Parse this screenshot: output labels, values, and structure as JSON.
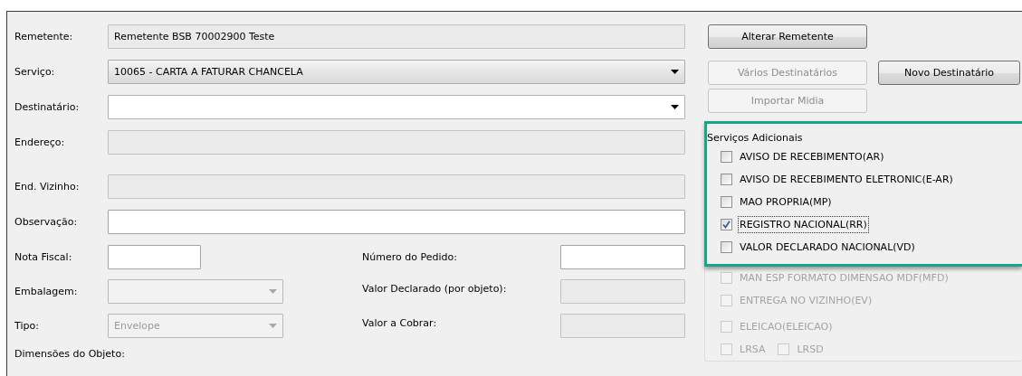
{
  "main_fields": [
    {
      "label": "Remetente:",
      "kind": "text",
      "editable": false,
      "value": "Remetente BSB 70002900 Teste"
    },
    {
      "label": "Serviço:",
      "kind": "select",
      "disabled": false,
      "value": "10065 - CARTA A FATURAR CHANCELA"
    },
    {
      "label": "Destinatário:",
      "kind": "combo",
      "disabled": false
    },
    {
      "label": "Endereço:",
      "kind": "text",
      "editable": false
    },
    {
      "label": "End. Vizinho:",
      "kind": "text",
      "editable": false
    },
    {
      "label": "Observação:",
      "kind": "text",
      "editable": true
    }
  ],
  "detail_left": [
    {
      "label": "Nota Fiscal:",
      "kind": "text",
      "editable": true
    },
    {
      "label": "Embalagem:",
      "kind": "select",
      "disabled": true
    },
    {
      "label": "Tipo:",
      "kind": "select",
      "disabled": true,
      "value": "Envelope"
    }
  ],
  "detail_right": [
    {
      "label": "Número do Pedido:",
      "kind": "text",
      "editable": true
    },
    {
      "label": "Valor Declarado (por objeto):",
      "kind": "text",
      "editable": false
    },
    {
      "label": "Valor a Cobrar:",
      "kind": "text",
      "editable": false
    }
  ],
  "dimensions_label": "Dimensões do Objeto:",
  "button_rows": [
    [
      {
        "label": "Alterar Remetente",
        "disabled": false
      }
    ],
    [
      {
        "label": "Vários Destinatários",
        "disabled": true
      },
      {
        "label": "Novo Destinatário",
        "disabled": false
      }
    ],
    [
      {
        "label": "Importar Midia",
        "disabled": true
      }
    ]
  ],
  "additional_services": {
    "title": "Serviços Adicionais",
    "highlighted_rows": [
      [
        {
          "label": "AVISO DE RECEBIMENTO(AR)",
          "checked": false,
          "disabled": false,
          "focused": false
        }
      ],
      [
        {
          "label": "AVISO DE RECEBIMENTO ELETRONIC(E-AR)",
          "checked": false,
          "disabled": false,
          "focused": false
        }
      ],
      [
        {
          "label": "MAO PROPRIA(MP)",
          "checked": false,
          "disabled": false,
          "focused": false
        }
      ],
      [
        {
          "label": "REGISTRO NACIONAL(RR)",
          "checked": true,
          "disabled": false,
          "focused": true
        }
      ],
      [
        {
          "label": "VALOR DECLARADO NACIONAL(VD)",
          "checked": false,
          "disabled": false,
          "focused": false
        }
      ]
    ],
    "rows": [
      [
        {
          "label": "MAN ESP FORMATO DIMENSAO MDF(MFD)",
          "checked": false,
          "disabled": true,
          "focused": false
        }
      ],
      [
        {
          "label": "ENTREGA NO VIZINHO(EV)",
          "checked": false,
          "disabled": true,
          "focused": false
        }
      ],
      [
        {
          "label": "ELEICAO(ELEICAO)",
          "checked": false,
          "disabled": true,
          "focused": false
        }
      ],
      [
        {
          "label": "LRSA",
          "checked": false,
          "disabled": true,
          "focused": false
        },
        {
          "label": "LRSD",
          "checked": false,
          "disabled": true,
          "focused": false
        }
      ]
    ]
  }
}
